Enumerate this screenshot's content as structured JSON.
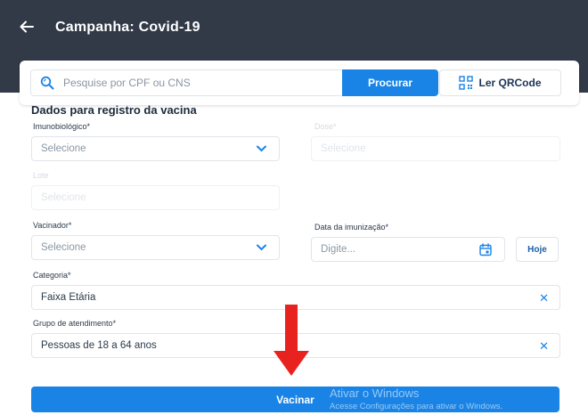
{
  "header": {
    "title": "Campanha: Covid-19"
  },
  "search": {
    "placeholder": "Pesquise por CPF ou CNS",
    "value": "",
    "button_label": "Procurar",
    "qr_label": "Ler QRCode"
  },
  "form": {
    "section_title": "Dados para registro da vacina",
    "imunobiologico": {
      "label": "Imunobiológico",
      "required_mark": "*",
      "value": "Selecione"
    },
    "dose": {
      "label": "Dose",
      "required_mark": "*",
      "value": "Selecione"
    },
    "lote": {
      "label": "Lote",
      "value": "Selecione"
    },
    "vacinador": {
      "label": "Vacinador",
      "required_mark": "*",
      "value": "Selecione"
    },
    "data_imunizacao": {
      "label": "Data da imunização",
      "required_mark": "*",
      "placeholder": "Digite..."
    },
    "hoje_label": "Hoje",
    "categoria": {
      "label": "Categoria",
      "required_mark": "*",
      "value": "Faixa Etária"
    },
    "grupo": {
      "label": "Grupo de atendimento",
      "required_mark": "*",
      "value": "Pessoas de 18 a 64 anos"
    }
  },
  "actions": {
    "vacinar_label": "Vacinar"
  },
  "watermark": {
    "title": "Ativar o Windows",
    "subtitle": "Acesse Configurações para ativar o Windows."
  },
  "colors": {
    "header_bg": "#323a48",
    "primary": "#1a84e6",
    "annotation_arrow": "#e8231f"
  },
  "icons": {
    "back": "arrow-left-icon",
    "search": "search-icon",
    "qr": "qr-code-icon",
    "dropdown": "chevron-down-icon",
    "clear": "close-icon",
    "calendar": "calendar-icon"
  }
}
